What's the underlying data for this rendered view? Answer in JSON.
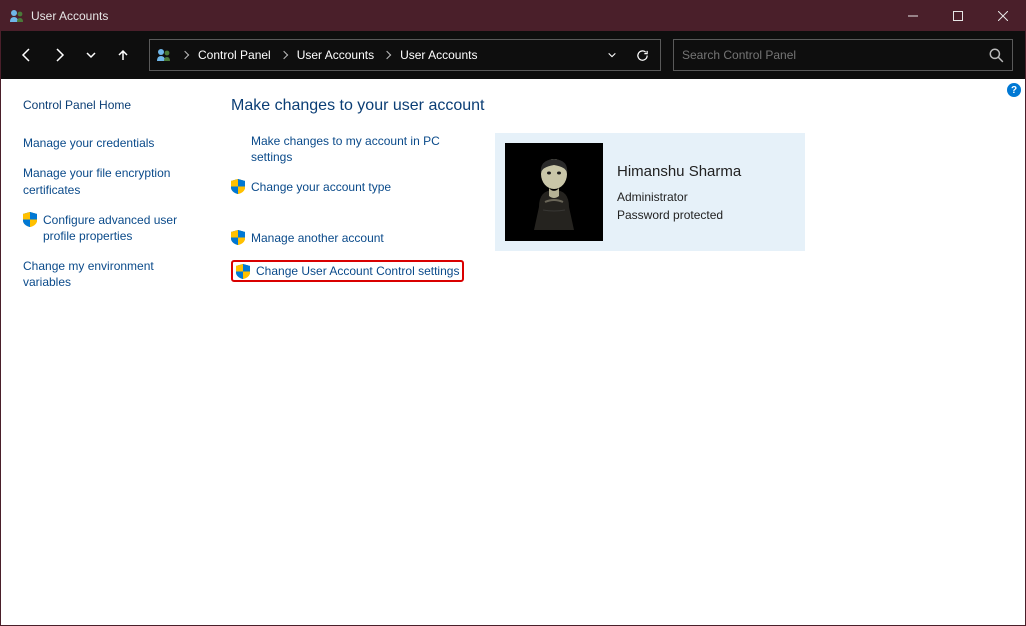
{
  "window": {
    "title": "User Accounts"
  },
  "breadcrumb": {
    "root": "Control Panel",
    "level1": "User Accounts",
    "level2": "User Accounts"
  },
  "search": {
    "placeholder": "Search Control Panel"
  },
  "sidebar": {
    "home": "Control Panel Home",
    "items": [
      "Manage your credentials",
      "Manage your file encryption certificates",
      "Configure advanced user profile properties",
      "Change my environment variables"
    ]
  },
  "main": {
    "heading": "Make changes to your user account",
    "links": {
      "pc_settings": "Make changes to my account in PC settings",
      "change_type": "Change your account type",
      "manage_another": "Manage another account",
      "uac_settings": "Change User Account Control settings"
    },
    "account": {
      "name": "Himanshu Sharma",
      "role": "Administrator",
      "password_status": "Password protected"
    }
  },
  "help": "?"
}
